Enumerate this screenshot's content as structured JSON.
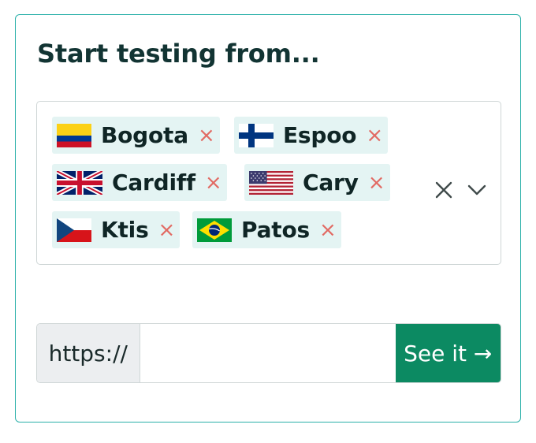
{
  "title": "Start testing from...",
  "locations": [
    {
      "label": "Bogota",
      "flag": "colombia-flag",
      "remove": "×"
    },
    {
      "label": "Espoo",
      "flag": "finland-flag",
      "remove": "×"
    },
    {
      "label": "Cardiff",
      "flag": "united-kingdom-flag",
      "remove": "×"
    },
    {
      "label": "Cary",
      "flag": "united-states-flag",
      "remove": "×"
    },
    {
      "label": "Ktis",
      "flag": "czech-republic-flag",
      "remove": "×"
    },
    {
      "label": "Patos",
      "flag": "brazil-flag",
      "remove": "×"
    }
  ],
  "url": {
    "prefix": "https://",
    "value": "",
    "button_label": "See it →"
  },
  "colors": {
    "border_accent": "#2ab0a9",
    "chip_bg": "#e4f4f3",
    "remove_x": "#e26a63",
    "button_bg": "#0c8a62"
  }
}
